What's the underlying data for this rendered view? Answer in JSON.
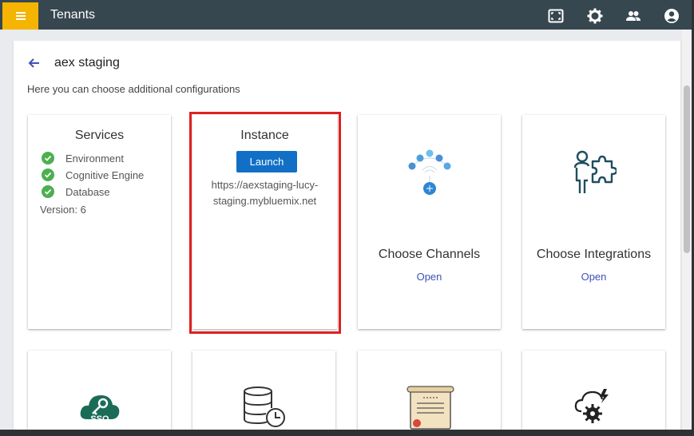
{
  "app": {
    "title": "Tenants"
  },
  "header": {
    "icons": [
      "fullscreen-icon",
      "gear-icon",
      "people-icon",
      "account-icon"
    ]
  },
  "page": {
    "title": "aex staging",
    "subtitle": "Here you can choose additional configurations"
  },
  "cards": {
    "services": {
      "title": "Services",
      "items": [
        "Environment",
        "Cognitive Engine",
        "Database"
      ],
      "version": "Version: 6",
      "check_color": "#4caf50"
    },
    "instance": {
      "title": "Instance",
      "button": "Launch",
      "url_line1": "https://aexstaging-lucy-",
      "url_line2": "staging.mybluemix.net"
    },
    "channels": {
      "title": "Choose Channels",
      "link": "Open"
    },
    "integrations": {
      "title": "Choose Integrations",
      "link": "Open"
    },
    "sso": {
      "icon_text": "SSO"
    }
  },
  "colors": {
    "topbar": "#37474f",
    "menu_button": "#f5b400",
    "accent_link": "#3f51b5",
    "launch_button": "#1170c6",
    "highlight": "#e02020",
    "icon_dark": "#1f4e5f"
  }
}
